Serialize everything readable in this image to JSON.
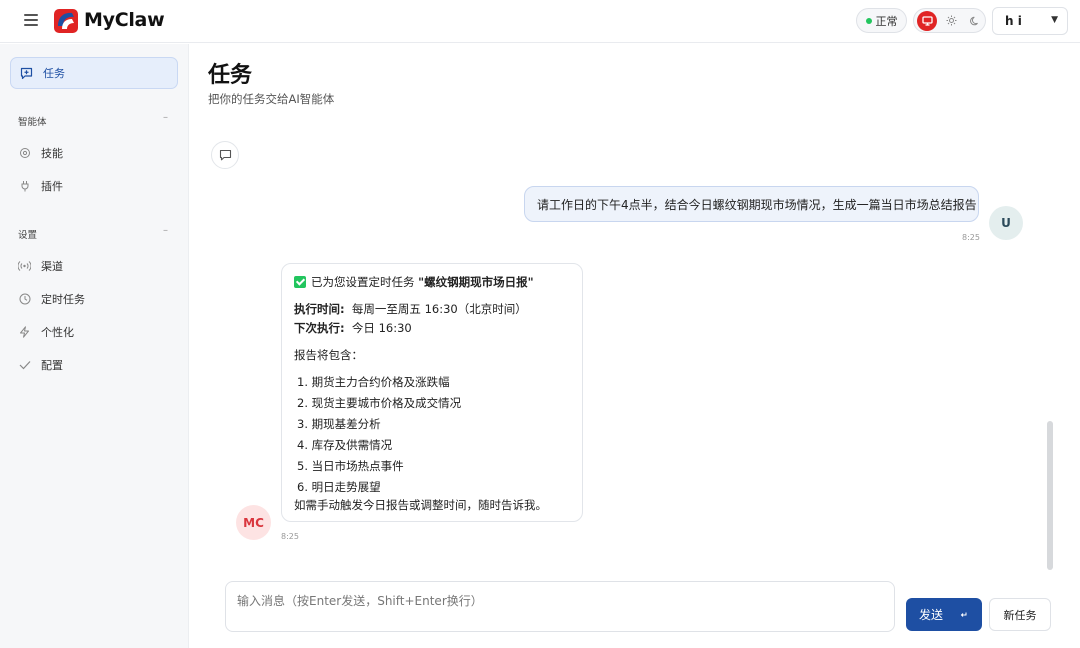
{
  "header": {
    "app_name": "MyClaw",
    "status_label": "正常",
    "user_name": "h    i"
  },
  "sidebar": {
    "tasks_label": "任务",
    "section_agent": "智能体",
    "skills_label": "技能",
    "plugins_label": "插件",
    "section_settings": "设置",
    "channels_label": "渠道",
    "scheduled_label": "定时任务",
    "personalize_label": "个性化",
    "config_label": "配置",
    "collapse_glyph": "–"
  },
  "main": {
    "title": "任务",
    "subtitle": "把你的任务交给AI智能体"
  },
  "messages": {
    "user_text": "请工作日的下午4点半，结合今日螺纹钢期现市场情况，生成一篇当日市场总结报告",
    "user_time": "8:25",
    "user_avatar": "U",
    "bot_avatar": "MC",
    "bot_time": "8:25",
    "bot_intro": "已为您设置定时任务",
    "bot_task_name": "\"螺纹钢期现市场日报\"",
    "exec_label": "执行时间:",
    "exec_value": "每周一至周五 16:30（北京时间）",
    "next_label": "下次执行:",
    "next_value": "今日 16:30",
    "report_intro": "报告将包含：",
    "items": [
      "1. 期货主力合约价格及涨跌幅",
      "2. 现货主要城市价格及成交情况",
      "3. 期现基差分析",
      "4. 库存及供需情况",
      "5. 当日市场热点事件",
      "6. 明日走势展望"
    ],
    "footer_note": "如需手动触发今日报告或调整时间，随时告诉我。"
  },
  "composer": {
    "placeholder": "输入消息（按Enter发送，Shift+Enter换行）",
    "send_label": "发送",
    "new_task_label": "新任务"
  },
  "colors": {
    "brand_red": "#e02424",
    "brand_blue": "#1e4fa3",
    "status_green": "#22c55e"
  }
}
